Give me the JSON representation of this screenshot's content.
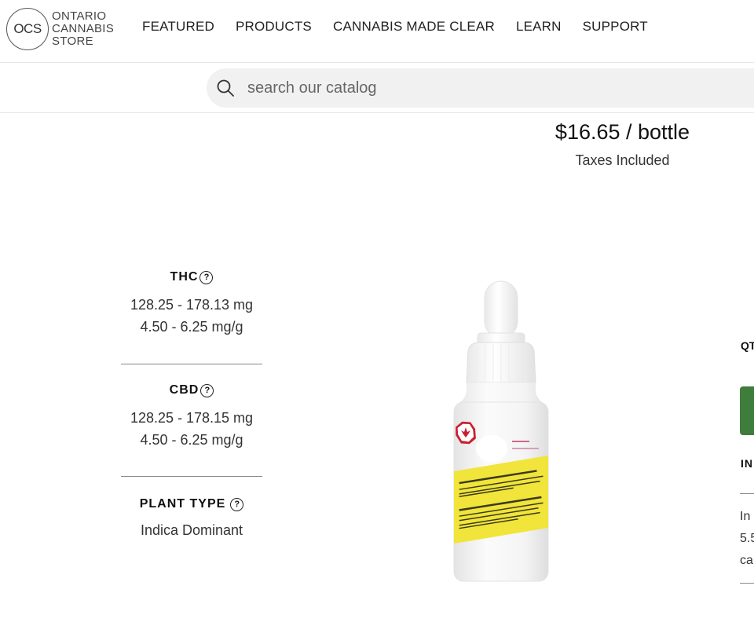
{
  "header": {
    "logo_mark": "OCS",
    "logo_lines": [
      "ONTARIO",
      "CANNABIS",
      "STORE"
    ],
    "nav": [
      "FEATURED",
      "PRODUCTS",
      "CANNABIS MADE CLEAR",
      "LEARN",
      "SUPPORT"
    ]
  },
  "search": {
    "placeholder": "search our catalog",
    "icon": "search-icon"
  },
  "product": {
    "price": "$16.65 / bottle",
    "taxes": "Taxes Included"
  },
  "specs": {
    "thc": {
      "title": "THC",
      "lines": [
        "128.25 - 178.13 mg",
        "4.50 - 6.25 mg/g"
      ]
    },
    "cbd": {
      "title": "CBD",
      "lines": [
        "128.25 - 178.15 mg",
        "4.50 - 6.25 mg/g"
      ]
    },
    "plant_type": {
      "title": "PLANT TYPE",
      "value": "Indica Dominant"
    },
    "help_glyph": "?"
  },
  "right_panel": {
    "qty_label": "QT",
    "info_label": "IN",
    "text_lines": [
      "In",
      "5.5",
      "ca"
    ]
  },
  "colors": {
    "add_button": "#3e7d3b",
    "search_bg": "#f1f1f1",
    "label_yellow": "#f1e43a",
    "thc_symbol_red": "#c8202f"
  }
}
